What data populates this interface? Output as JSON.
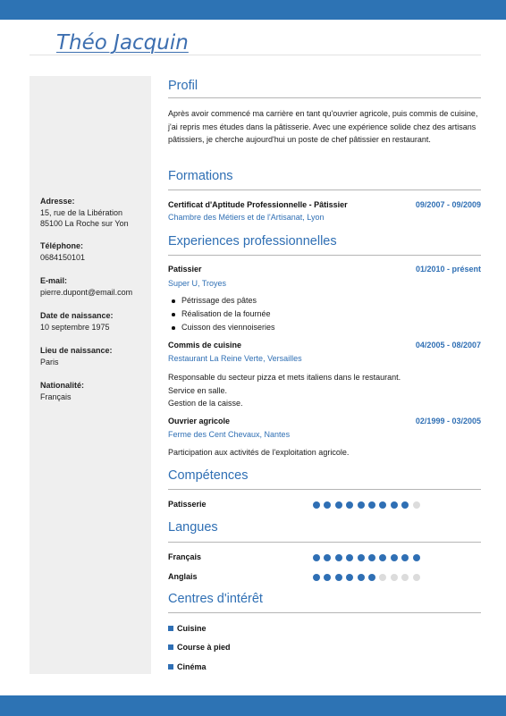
{
  "name": "Théo Jacquin",
  "colors": {
    "accent": "#2d73b4",
    "sidebar": "#efefef"
  },
  "sidebar": {
    "address_label": "Adresse:",
    "address_line1": "15, rue de la Libération",
    "address_line2": "85100 La Roche sur Yon",
    "phone_label": "Téléphone:",
    "phone": "0684150101",
    "email_label": "E-mail:",
    "email": "pierre.dupont@email.com",
    "birthdate_label": "Date de naissance:",
    "birthdate": "10 septembre 1975",
    "birthplace_label": "Lieu de naissance:",
    "birthplace": "Paris",
    "nationality_label": "Nationalité:",
    "nationality": "Français"
  },
  "profile": {
    "title": "Profil",
    "text": "Après avoir commencé ma carrière en tant qu'ouvrier agricole, puis commis de cuisine, j'ai repris mes études dans la pâtisserie. Avec une expérience solide chez des artisans pâtissiers, je cherche aujourd'hui un poste de chef pâtissier en restaurant."
  },
  "education": {
    "title": "Formations",
    "items": [
      {
        "title": "Certificat d'Aptitude Professionnelle - Pâtissier",
        "date": "09/2007 - 09/2009",
        "org": "Chambre des Métiers et de l'Artisanat, Lyon"
      }
    ]
  },
  "experience": {
    "title": "Experiences professionnelles",
    "items": [
      {
        "title": "Patissier",
        "date": "01/2010 - présent",
        "org": "Super U, Troyes",
        "bullets": [
          "Pétrissage des pâtes",
          "Réalisation de la fournée",
          "Cuisson des viennoiseries"
        ]
      },
      {
        "title": "Commis de cuisine",
        "date": "04/2005 - 08/2007",
        "org": "Restaurant La Reine Verte, Versailles",
        "lines": [
          "Responsable du secteur pizza et mets italiens dans le restaurant.",
          "Service en salle.",
          "Gestion de la caisse."
        ]
      },
      {
        "title": "Ouvrier agricole",
        "date": "02/1999 - 03/2005",
        "org": "Ferme des Cent Chevaux, Nantes",
        "lines": [
          "Participation aux activités de l'exploitation agricole."
        ]
      }
    ]
  },
  "skills": {
    "title": "Compétences",
    "items": [
      {
        "label": "Patisserie",
        "level": 9,
        "max": 10
      }
    ]
  },
  "languages": {
    "title": "Langues",
    "items": [
      {
        "label": "Français",
        "level": 10,
        "max": 10
      },
      {
        "label": "Anglais",
        "level": 6,
        "max": 10
      }
    ]
  },
  "interests": {
    "title": "Centres d'intérêt",
    "items": [
      "Cuisine",
      "Course à pied",
      "Cinéma"
    ]
  }
}
